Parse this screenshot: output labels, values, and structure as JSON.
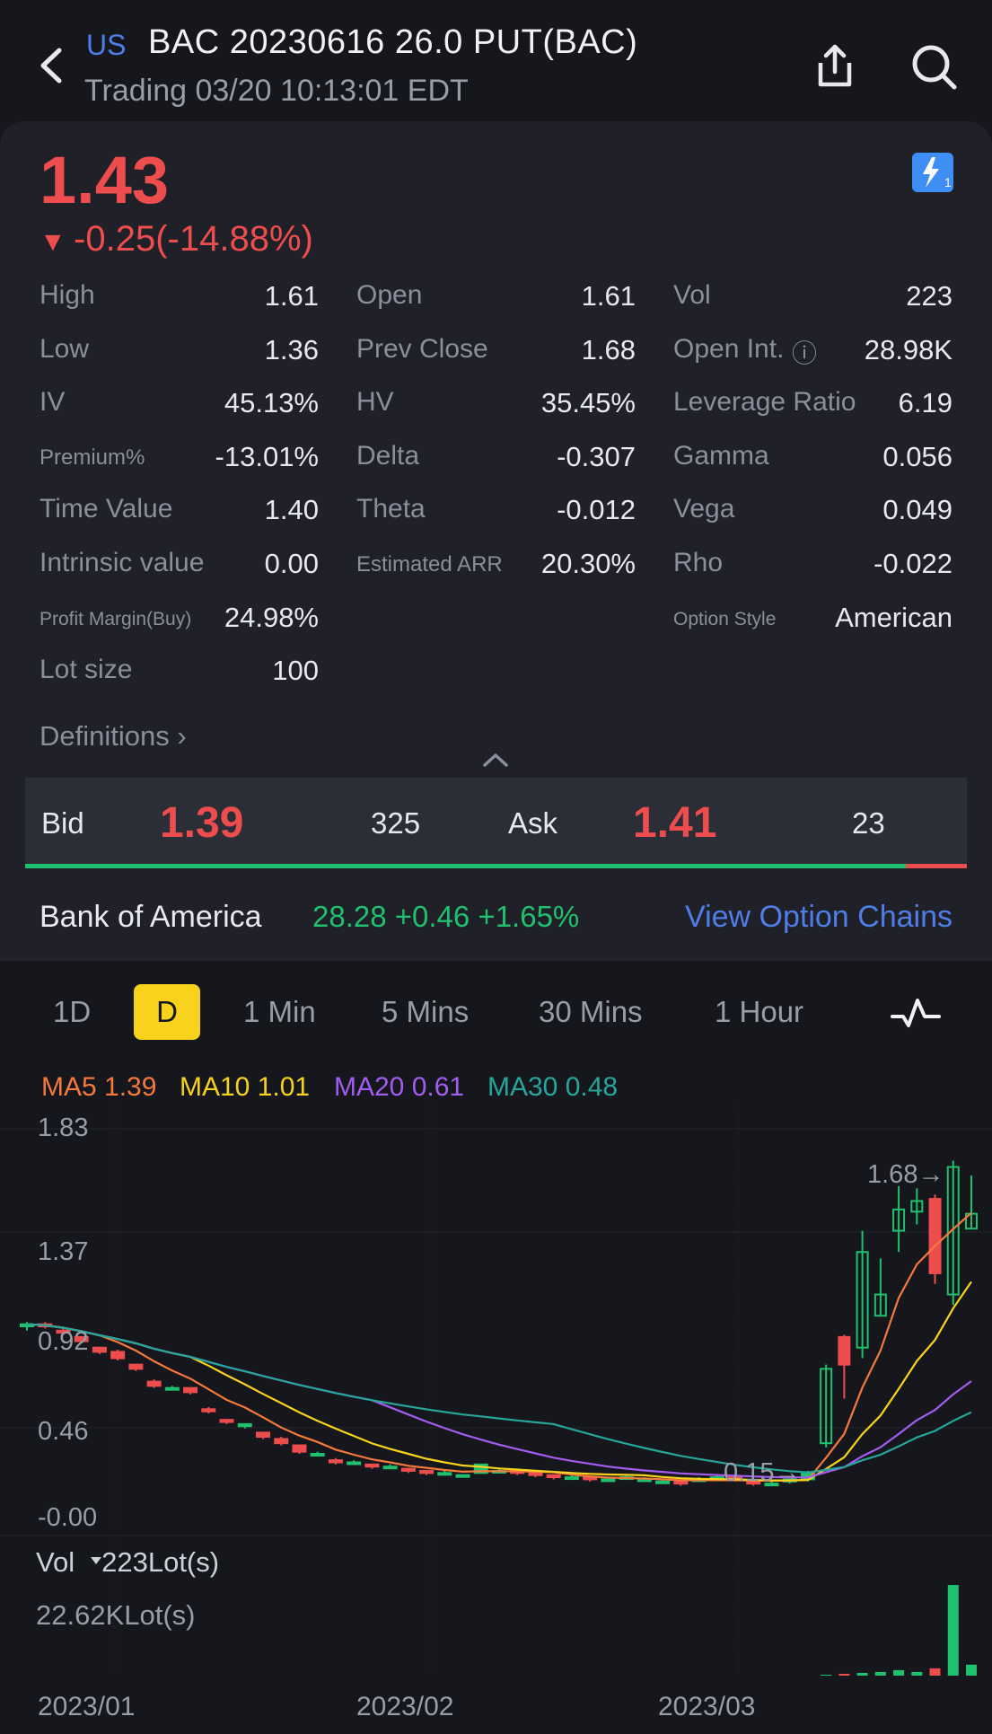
{
  "header": {
    "market_badge": "US",
    "title": "BAC 20230616 26.0 PUT(BAC)",
    "subtitle": "Trading  03/20 10:13:01 EDT"
  },
  "quote": {
    "price": "1.43",
    "change": "-0.25(-14.88%)"
  },
  "stats": [
    {
      "label": "High",
      "value": "1.61"
    },
    {
      "label": "Open",
      "value": "1.61"
    },
    {
      "label": "Vol",
      "value": "223"
    },
    {
      "label": "Low",
      "value": "1.36"
    },
    {
      "label": "Prev Close",
      "value": "1.68"
    },
    {
      "label": "Open Int.",
      "value": "28.98K"
    },
    {
      "label": "IV",
      "value": "45.13%"
    },
    {
      "label": "HV",
      "value": "35.45%"
    },
    {
      "label": "Leverage Ratio",
      "value": "6.19"
    },
    {
      "label": "Premium%",
      "value": "-13.01%"
    },
    {
      "label": "Delta",
      "value": "-0.307"
    },
    {
      "label": "Gamma",
      "value": "0.056"
    },
    {
      "label": "Time Value",
      "value": "1.40"
    },
    {
      "label": "Theta",
      "value": "-0.012"
    },
    {
      "label": "Vega",
      "value": "0.049"
    },
    {
      "label": "Intrinsic value",
      "value": "0.00"
    },
    {
      "label": "Estimated ARR",
      "value": "20.30%"
    },
    {
      "label": "Rho",
      "value": "-0.022"
    },
    {
      "label": "Profit Margin(Buy)",
      "value": "24.98%"
    },
    {
      "label": "Option Style",
      "value": "American"
    },
    {
      "label": "Lot size",
      "value": "100"
    }
  ],
  "definitions_label": "Definitions",
  "bidask": {
    "bid_label": "Bid",
    "bid_price": "1.39",
    "bid_size": "325",
    "ask_label": "Ask",
    "ask_price": "1.41",
    "ask_size": "23",
    "bid_share": 0.935
  },
  "underlying": {
    "name": "Bank of America",
    "quote": "28.28 +0.46 +1.65%",
    "link": "View Option Chains"
  },
  "tabs": [
    "1D",
    "D",
    "1 Min",
    "5 Mins",
    "30 Mins",
    "1 Hour"
  ],
  "active_tab": "D",
  "ma_legend": [
    {
      "label": "MA5 1.39",
      "color": "#f5793b"
    },
    {
      "label": "MA10 1.01",
      "color": "#f8d21c"
    },
    {
      "label": "MA20 0.61",
      "color": "#a35cf0"
    },
    {
      "label": "MA30 0.48",
      "color": "#26a69a"
    }
  ],
  "colors": {
    "up": "#1fc06e",
    "down": "#ee4d4d",
    "accent": "#4f7ee8"
  },
  "chart_data": {
    "type": "candlestick",
    "ylim": [
      0,
      1.83
    ],
    "y_ticks": [
      "1.83",
      "1.37",
      "0.92",
      "0.46",
      "-0.00"
    ],
    "x_labels": [
      "2023/01",
      "2023/02",
      "2023/03"
    ],
    "annotations": {
      "high": "1.68",
      "low": "0.15"
    },
    "candles": [
      [
        0.9,
        0.92,
        0.88,
        0.91
      ],
      [
        0.91,
        0.92,
        0.89,
        0.9
      ],
      [
        0.88,
        0.89,
        0.86,
        0.87
      ],
      [
        0.85,
        0.85,
        0.82,
        0.83
      ],
      [
        0.8,
        0.8,
        0.77,
        0.78
      ],
      [
        0.78,
        0.79,
        0.74,
        0.75
      ],
      [
        0.72,
        0.72,
        0.69,
        0.7
      ],
      [
        0.64,
        0.65,
        0.61,
        0.62
      ],
      [
        0.61,
        0.62,
        0.61,
        0.61
      ],
      [
        0.61,
        0.61,
        0.58,
        0.59
      ],
      [
        0.51,
        0.52,
        0.49,
        0.5
      ],
      [
        0.46,
        0.46,
        0.44,
        0.45
      ],
      [
        0.43,
        0.44,
        0.42,
        0.44
      ],
      [
        0.4,
        0.4,
        0.37,
        0.38
      ],
      [
        0.37,
        0.38,
        0.34,
        0.35
      ],
      [
        0.34,
        0.34,
        0.3,
        0.31
      ],
      [
        0.3,
        0.31,
        0.29,
        0.3
      ],
      [
        0.27,
        0.28,
        0.25,
        0.26
      ],
      [
        0.26,
        0.27,
        0.25,
        0.26
      ],
      [
        0.25,
        0.25,
        0.23,
        0.24
      ],
      [
        0.24,
        0.25,
        0.23,
        0.24
      ],
      [
        0.23,
        0.23,
        0.21,
        0.22
      ],
      [
        0.22,
        0.22,
        0.2,
        0.21
      ],
      [
        0.21,
        0.22,
        0.2,
        0.21
      ],
      [
        0.2,
        0.2,
        0.19,
        0.2
      ],
      [
        0.21,
        0.25,
        0.21,
        0.25
      ],
      [
        0.22,
        0.23,
        0.21,
        0.22
      ],
      [
        0.22,
        0.22,
        0.2,
        0.21
      ],
      [
        0.21,
        0.21,
        0.19,
        0.2
      ],
      [
        0.2,
        0.2,
        0.18,
        0.19
      ],
      [
        0.19,
        0.2,
        0.18,
        0.19
      ],
      [
        0.19,
        0.19,
        0.17,
        0.18
      ],
      [
        0.18,
        0.19,
        0.17,
        0.18
      ],
      [
        0.19,
        0.2,
        0.18,
        0.19
      ],
      [
        0.18,
        0.19,
        0.17,
        0.18
      ],
      [
        0.17,
        0.18,
        0.16,
        0.17
      ],
      [
        0.17,
        0.17,
        0.15,
        0.16
      ],
      [
        0.18,
        0.19,
        0.17,
        0.18
      ],
      [
        0.19,
        0.2,
        0.18,
        0.19
      ],
      [
        0.19,
        0.19,
        0.17,
        0.18
      ],
      [
        0.17,
        0.17,
        0.15,
        0.16
      ],
      [
        0.16,
        0.17,
        0.15,
        0.16
      ],
      [
        0.17,
        0.19,
        0.16,
        0.18
      ],
      [
        0.18,
        0.22,
        0.17,
        0.21
      ],
      [
        0.35,
        0.72,
        0.33,
        0.7
      ],
      [
        0.85,
        0.86,
        0.56,
        0.72
      ],
      [
        0.8,
        1.35,
        0.75,
        1.25
      ],
      [
        0.95,
        1.22,
        0.95,
        1.05
      ],
      [
        1.35,
        1.56,
        1.25,
        1.45
      ],
      [
        1.44,
        1.55,
        1.38,
        1.49
      ],
      [
        1.5,
        1.52,
        1.1,
        1.15
      ],
      [
        1.05,
        1.68,
        1.0,
        1.65
      ],
      [
        1.36,
        1.61,
        1.36,
        1.43
      ]
    ],
    "volume_label": "Vol",
    "volume_current": "223Lot(s)",
    "volume_max": "22.62KLot(s)",
    "volumes": [
      0,
      0,
      0,
      0,
      0,
      0,
      0,
      0,
      0,
      0,
      0,
      0,
      0,
      0,
      0,
      0,
      0,
      0,
      0,
      0,
      0,
      0,
      0,
      0,
      0,
      0,
      0,
      0,
      0,
      0,
      0,
      0,
      0,
      0,
      0,
      0,
      0,
      0,
      0,
      0,
      0,
      0,
      0,
      0,
      0.01,
      0.02,
      0.03,
      0.04,
      0.06,
      0.04,
      0.08,
      0.99,
      0.12
    ]
  }
}
